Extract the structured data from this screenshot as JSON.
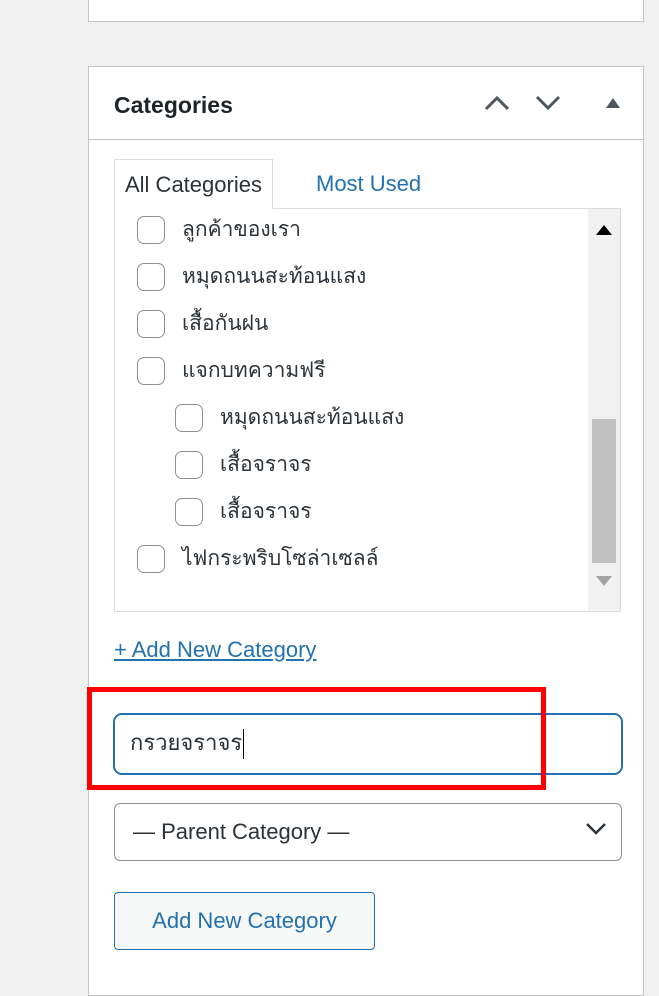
{
  "panel": {
    "title": "Categories",
    "move_up_icon": "chevron-up-icon",
    "move_down_icon": "chevron-down-icon",
    "toggle_icon": "triangle-up-icon"
  },
  "tabs": [
    {
      "label": "All Categories",
      "active": true
    },
    {
      "label": "Most Used",
      "active": false
    }
  ],
  "categories": [
    {
      "label": "ลูกค้าของเรา",
      "checked": false,
      "level": 0
    },
    {
      "label": "หมุดถนนสะท้อนแสง",
      "checked": false,
      "level": 0
    },
    {
      "label": "เสื้อกันฝน",
      "checked": false,
      "level": 0
    },
    {
      "label": "แจกบทความฟรี",
      "checked": false,
      "level": 0
    },
    {
      "label": "หมุดถนนสะท้อนแสง",
      "checked": false,
      "level": 1
    },
    {
      "label": "เสื้อจราจร",
      "checked": false,
      "level": 1
    },
    {
      "label": "เสื้อจราจร",
      "checked": false,
      "level": 1
    },
    {
      "label": "ไฟกระพริบโซล่าเซลล์",
      "checked": false,
      "level": 0
    }
  ],
  "add_new": {
    "link_label": "+ Add New Category",
    "name_value": "กรวยจราจร",
    "parent_select_value": "— Parent Category —",
    "submit_label": "Add New Category"
  },
  "colors": {
    "accent": "#2271b1",
    "highlight": "#ff0000"
  }
}
